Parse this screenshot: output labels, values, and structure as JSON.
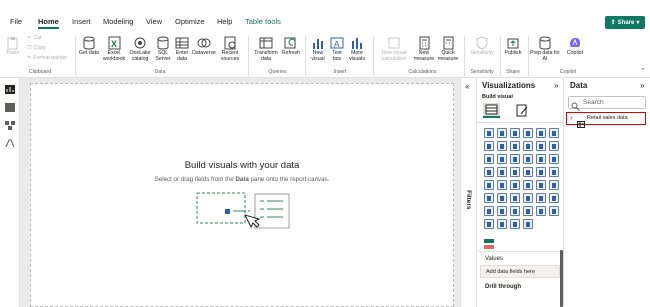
{
  "menu": {
    "items": [
      "File",
      "Home",
      "Insert",
      "Modeling",
      "View",
      "Optimize",
      "Help",
      "Table tools"
    ],
    "active": "Home",
    "share": "Share"
  },
  "ribbon": {
    "clipboard": {
      "paste": "Paste",
      "cut": "Cut",
      "copy": "Copy",
      "format_painter": "Format painter",
      "group": "Clipboard"
    },
    "data": {
      "get_data": "Get data",
      "excel": "Excel workbook",
      "onelake": "OneLake catalog",
      "sql": "SQL Server",
      "enter_data": "Enter data",
      "dataverse": "Dataverse",
      "recent": "Recent sources",
      "group": "Data"
    },
    "queries": {
      "transform": "Transform data",
      "refresh": "Refresh",
      "group": "Queries"
    },
    "insert": {
      "new_visual": "New visual",
      "text_box": "Text box",
      "more_visuals": "More visuals",
      "group": "Insert"
    },
    "calculations": {
      "new_visual_calc": "New visual calculation",
      "new_measure": "New measure",
      "quick_measure": "Quick measure",
      "group": "Calculations"
    },
    "sensitivity": {
      "label": "Sensitivity",
      "group": "Sensitivity"
    },
    "share": {
      "publish": "Publish",
      "group": "Share"
    },
    "copilot": {
      "prep": "Prep data for AI",
      "copilot": "Copilot",
      "group": "Copilot"
    }
  },
  "canvas": {
    "title": "Build visuals with your data",
    "subtitle_pre": "Select or drag fields from the ",
    "subtitle_bold": "Data",
    "subtitle_post": " pane onto the report canvas."
  },
  "filters": {
    "label": "Filters"
  },
  "viz": {
    "title": "Visualizations",
    "build": "Build visual",
    "values": "Values",
    "add_fields": "Add data fields here",
    "drill": "Drill through"
  },
  "data_pane": {
    "title": "Data",
    "search_placeholder": "Search",
    "table": "Retail sales data"
  },
  "colors": {
    "accent": "#117865",
    "highlight": "#e00000"
  }
}
